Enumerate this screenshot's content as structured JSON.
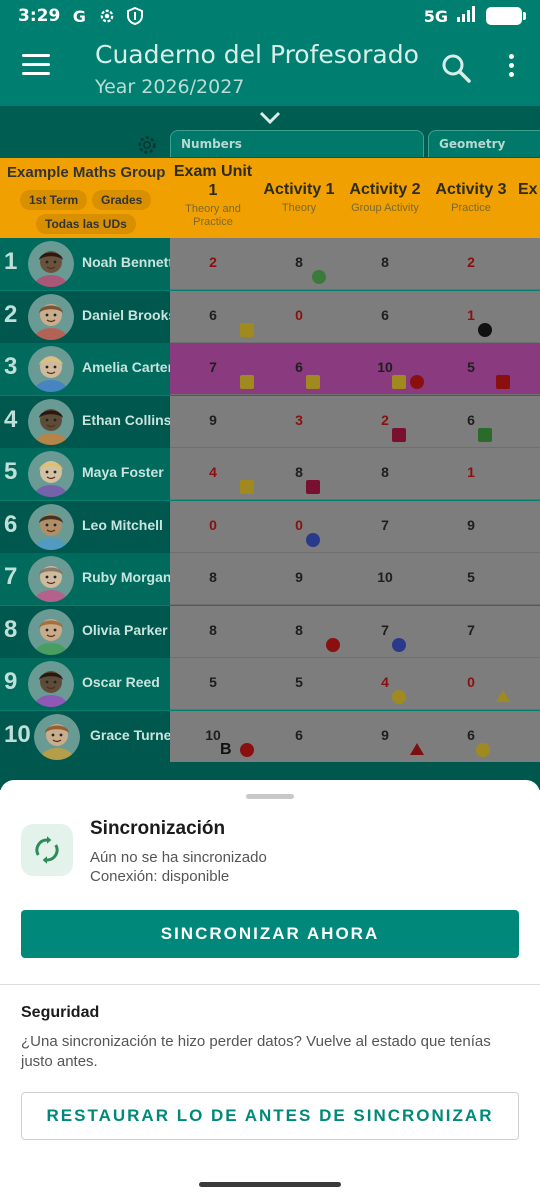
{
  "status_bar": {
    "time": "3:29",
    "icons": [
      "google-icon",
      "settings-icon",
      "shield-icon"
    ],
    "network": "5G",
    "signal_icon": "signal-icon",
    "battery_icon": "battery-icon"
  },
  "toolbar": {
    "title": "Cuaderno del Profesorado",
    "subtitle": "Year 2026/2027",
    "menu_icon": "hamburger-menu-icon",
    "search_icon": "search-icon",
    "more_icon": "more-vert-icon"
  },
  "units": {
    "expand_icon": "chevron-down-icon",
    "settings_icon": "gear-icon",
    "items": [
      "Numbers",
      "Geometry"
    ]
  },
  "group": {
    "name": "Example Maths Group",
    "term": "1st Term",
    "grades": "Grades",
    "all_units": "Todas las UDs"
  },
  "columns": [
    {
      "title": "Exam Unit 1",
      "subtitle": "Theory and Practice"
    },
    {
      "title": "Activity 1",
      "subtitle": "Theory"
    },
    {
      "title": "Activity 2",
      "subtitle": "Group Activity"
    },
    {
      "title": "Activity 3",
      "subtitle": "Practice"
    },
    {
      "title": "Ex",
      "subtitle": ""
    }
  ],
  "students": [
    {
      "num": "1",
      "name": "Noah Bennett",
      "grades": [
        "2",
        "8",
        "8",
        "2"
      ],
      "skin": "#6b3b1f",
      "hair": "#1a0d06",
      "shirt": "#c43a6a"
    },
    {
      "num": "2",
      "name": "Daniel Brooks",
      "grades": [
        "6",
        "0",
        "6",
        "1"
      ],
      "skin": "#e8b48a",
      "hair": "#6b3d1c",
      "shirt": "#d44a3a"
    },
    {
      "num": "3",
      "name": "Amelia Carter",
      "grades": [
        "7",
        "6",
        "10",
        "5"
      ],
      "skin": "#f2c4a0",
      "hair": "#d9c47a",
      "shirt": "#3a7ad4"
    },
    {
      "num": "4",
      "name": "Ethan Collins",
      "grades": [
        "9",
        "3",
        "2",
        "6"
      ],
      "skin": "#5a3218",
      "hair": "#1a0d06",
      "shirt": "#d47a2a"
    },
    {
      "num": "5",
      "name": "Maya Foster",
      "grades": [
        "4",
        "8",
        "8",
        "1"
      ],
      "skin": "#f5cfa8",
      "hair": "#e0c060",
      "shirt": "#7a4ab4"
    },
    {
      "num": "6",
      "name": "Leo Mitchell",
      "grades": [
        "0",
        "0",
        "7",
        "9"
      ],
      "skin": "#c88a5a",
      "hair": "#2a1a0a",
      "shirt": "#4a9ad4"
    },
    {
      "num": "7",
      "name": "Ruby Morgan",
      "grades": [
        "8",
        "9",
        "10",
        "5"
      ],
      "skin": "#f0c4a0",
      "hair": "#7a6a5a",
      "shirt": "#d44a8a"
    },
    {
      "num": "8",
      "name": "Olivia Parker",
      "grades": [
        "8",
        "8",
        "7",
        "7"
      ],
      "skin": "#e8b088",
      "hair": "#a0602a",
      "shirt": "#3aa04a"
    },
    {
      "num": "9",
      "name": "Oscar Reed",
      "grades": [
        "5",
        "5",
        "4",
        "0"
      ],
      "skin": "#5a3218",
      "hair": "#1a0d06",
      "shirt": "#a03ac4"
    },
    {
      "num": "10",
      "name": "Grace Turner",
      "grades": [
        "10",
        "6",
        "9",
        "6"
      ],
      "skin": "#e8b48a",
      "hair": "#8a4a1a",
      "shirt": "#d4a02a"
    }
  ],
  "grade_marks": {
    "extra_b": "B"
  },
  "sheet": {
    "title": "Sincronización",
    "status": "Aún no se ha sincronizado",
    "connection": "Conexión: disponible",
    "sync_button": "SINCRONIZAR AHORA",
    "security_title": "Seguridad",
    "security_desc": "¿Una sincronización te hizo perder datos? Vuelve al estado que tenías justo antes.",
    "restore_button": "RESTAURAR LO DE ANTES DE SINCRONIZAR",
    "sync_icon": "sync-icon",
    "accent_color": "#00897b"
  }
}
